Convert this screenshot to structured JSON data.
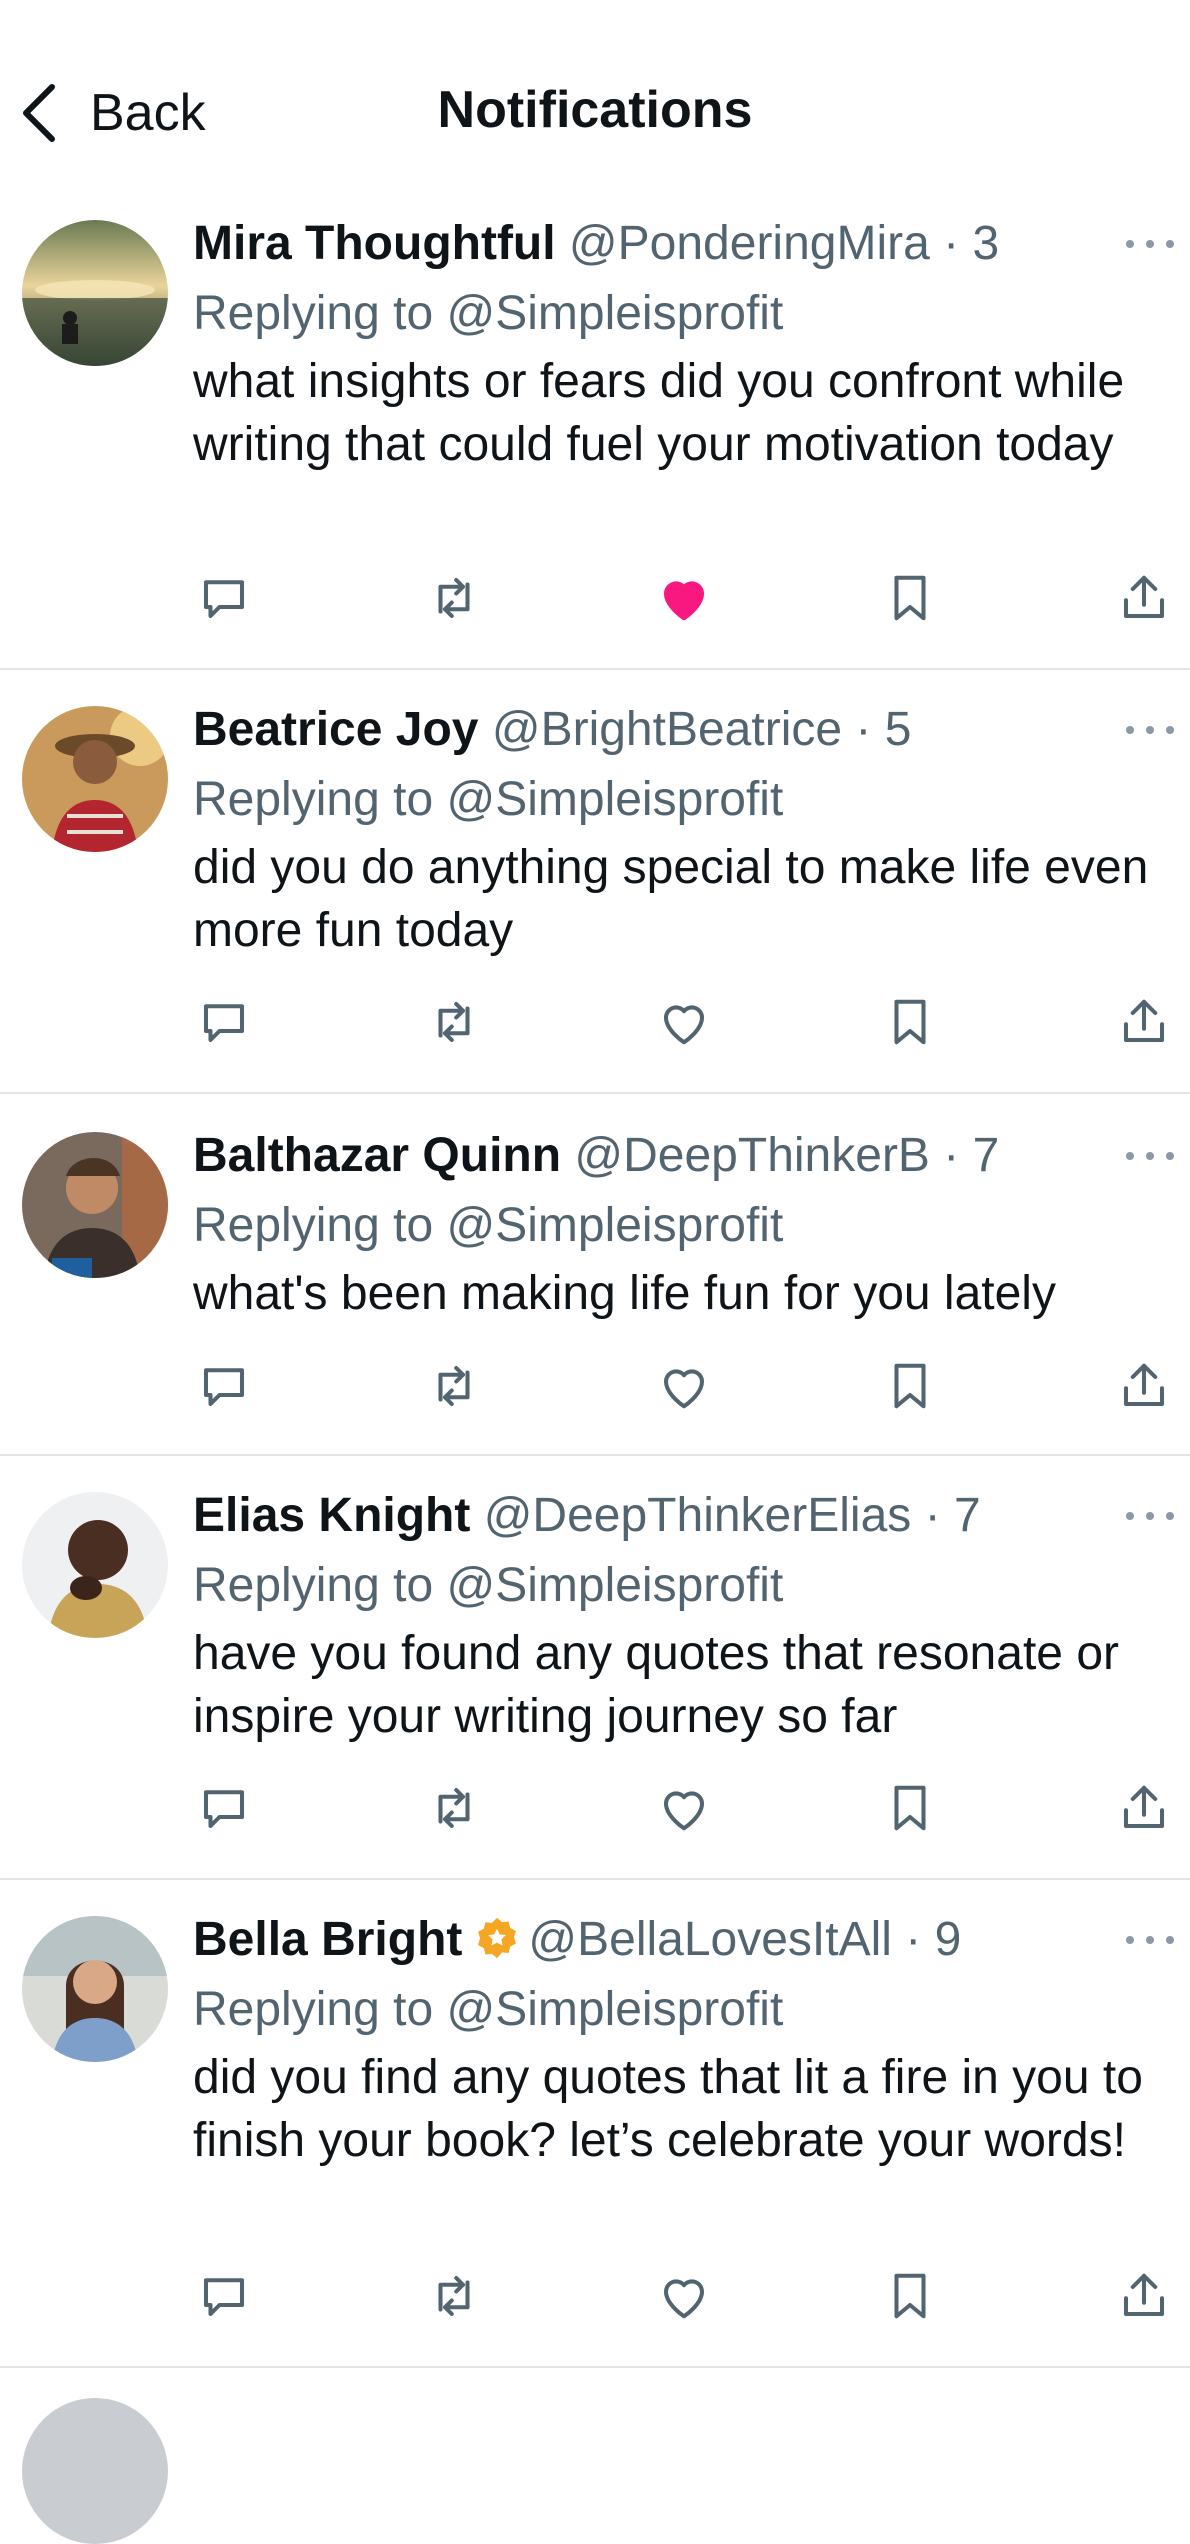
{
  "header": {
    "back_label": "Back",
    "title": "Notifications"
  },
  "notifications": [
    {
      "name": "Mira Thoughtful",
      "handle": "@PonderingMira",
      "time": "3",
      "reply": "Replying to @Simpleisprofit",
      "text": "what insights or fears did you confront while writing that could fuel your motivation today",
      "liked": true,
      "verified": false
    },
    {
      "name": "Beatrice Joy",
      "handle": "@BrightBeatrice",
      "time": "5",
      "reply": "Replying to @Simpleisprofit",
      "text": "did you do anything special to make life even more fun today",
      "liked": false,
      "verified": false
    },
    {
      "name": "Balthazar Quinn",
      "handle": "@DeepThinkerB",
      "time": "7",
      "reply": "Replying to @Simpleisprofit",
      "text": "what's been making life fun for you lately",
      "liked": false,
      "verified": false
    },
    {
      "name": "Elias Knight",
      "handle": "@DeepThinkerElias",
      "time": "7",
      "reply": "Replying to @Simpleisprofit",
      "text": "have you found any quotes that resonate or inspire your writing journey so far",
      "liked": false,
      "verified": false
    },
    {
      "name": "Bella Bright",
      "handle": "@BellaLovesItAll",
      "time": "9",
      "reply": "Replying to @Simpleisprofit",
      "text": "did you find any quotes that lit a fire in you to finish your book? let’s celebrate your words!",
      "liked": false,
      "verified": true
    }
  ],
  "colors": {
    "like_active": "#f91880",
    "icon": "#536471",
    "verified": "#f5a623"
  },
  "icons": [
    "chevron-left-icon",
    "more-icon",
    "reply-icon",
    "retweet-icon",
    "heart-icon",
    "bookmark-icon",
    "share-icon",
    "verified-badge-icon"
  ]
}
